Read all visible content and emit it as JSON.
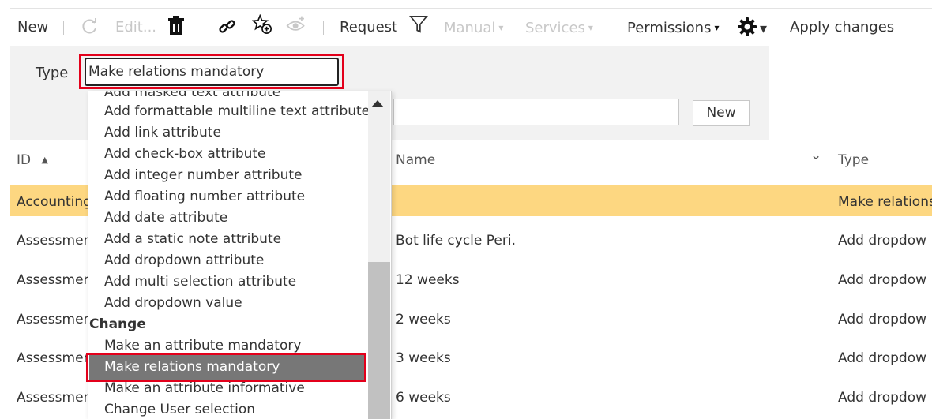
{
  "toolbar": {
    "new": "New",
    "edit": "Edit...",
    "request": "Request",
    "manual": "Manual",
    "services": "Services",
    "permissions": "Permissions",
    "apply_changes": "Apply changes",
    "caret": "▾"
  },
  "filter": {
    "type_label": "Type",
    "type_value": "Make relations mandatory",
    "name_value": "",
    "new_button": "New"
  },
  "table": {
    "headers": {
      "id": "ID",
      "name": "Name",
      "type": "Type",
      "sort_asc": "▲",
      "chevron": "⌄"
    },
    "rows": [
      {
        "id": "Accounting",
        "name": "",
        "type": "Make relations"
      },
      {
        "id": "Assessmen",
        "name": "Bot life cycle Peri.",
        "type": "Add dropdow"
      },
      {
        "id": "Assessmen",
        "name": "12 weeks",
        "type": "Add dropdow"
      },
      {
        "id": "Assessmen",
        "name": "2 weeks",
        "type": "Add dropdow"
      },
      {
        "id": "Assessmen",
        "name": "3 weeks",
        "type": "Add dropdow"
      },
      {
        "id": "Assessmen",
        "name": "6 weeks",
        "type": "Add dropdow"
      }
    ]
  },
  "dropdown": {
    "items_top": [
      "Add masked text attribute",
      "Add formattable multiline text attribute",
      "Add link attribute",
      "Add check-box attribute",
      "Add integer number attribute",
      "Add floating number attribute",
      "Add date attribute",
      "Add a static note attribute",
      "Add dropdown attribute",
      "Add multi selection attribute",
      "Add dropdown value"
    ],
    "group_change": "Change",
    "items_change": [
      "Make an attribute mandatory",
      "Make relations mandatory",
      "Make an attribute informative",
      "Change User selection"
    ]
  },
  "colors": {
    "highlight_row": "#fdd781",
    "selected_item": "#777777",
    "annotation_red": "#e3001b"
  }
}
